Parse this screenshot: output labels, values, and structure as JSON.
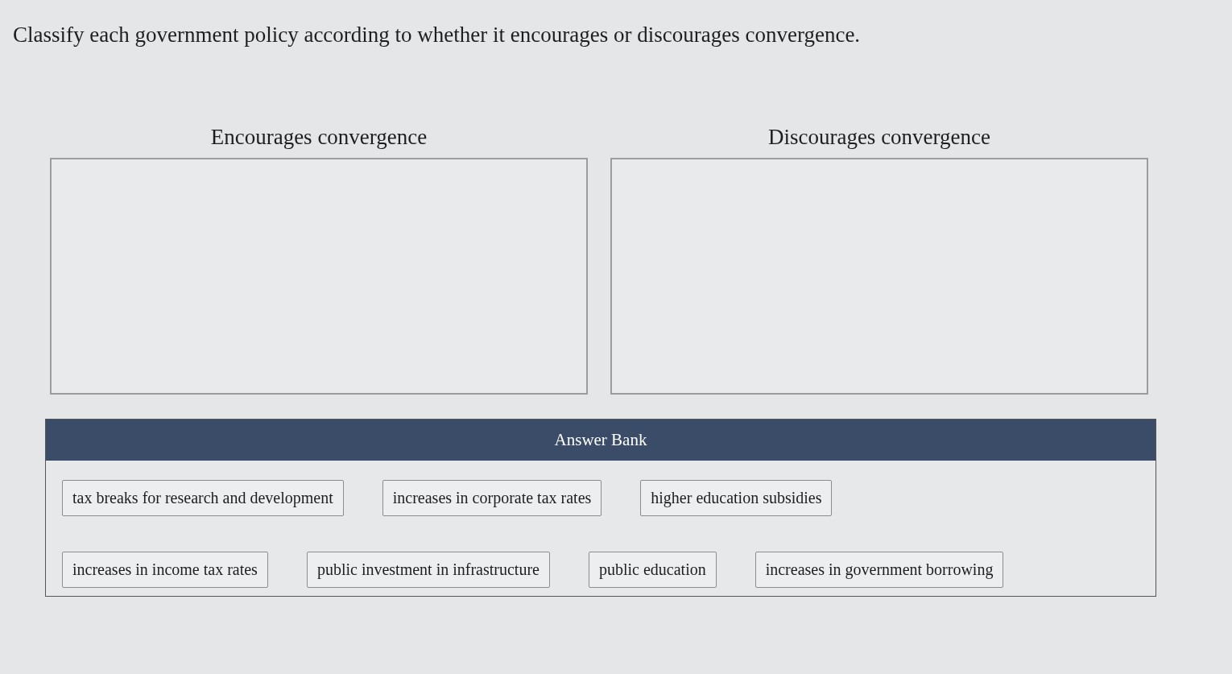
{
  "instruction": "Classify each government policy according to whether it encourages or discourages convergence.",
  "bins": [
    {
      "heading": "Encourages convergence"
    },
    {
      "heading": "Discourages convergence"
    }
  ],
  "answer_bank": {
    "title": "Answer Bank",
    "rows": [
      [
        "tax breaks for research and development",
        "increases in corporate tax rates",
        "higher education subsidies"
      ],
      [
        "increases in income tax rates",
        "public investment in infrastructure",
        "public education",
        "increases in government borrowing"
      ]
    ]
  }
}
